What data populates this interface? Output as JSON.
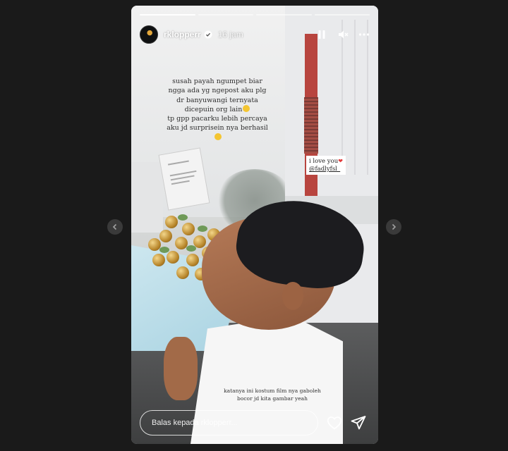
{
  "story": {
    "progress_segments": 4,
    "active_segment": 0,
    "username": "rklopperr",
    "verified": true,
    "time_ago": "16 jam",
    "caption_lines": [
      "susah payah ngumpet biar",
      "ngga ada yg ngepost aku plg",
      "dr banyuwangi ternyata",
      "dicepuin org lain",
      "tp gpp pacarku lebih percaya",
      "aku jd surprisein nya berhasil"
    ],
    "mention_text": "i love you",
    "mention_handle": "@fadlyfsl_",
    "bottom_caption_lines": [
      "katanya ini kostum film nya gaboleh",
      "bocor jd kita gambar yeah"
    ],
    "reply_placeholder": "Balas kepada rklopperr..."
  },
  "icons": {
    "pause": "pause-icon",
    "mute": "muted-speaker-icon",
    "more": "more-horizontal-icon",
    "like": "heart-icon",
    "share": "paper-plane-icon",
    "prev": "chevron-left-icon",
    "next": "chevron-right-icon"
  },
  "colors": {
    "background": "#1a1a1a",
    "heart": "#e23b3b",
    "verified": "#3897f0"
  }
}
